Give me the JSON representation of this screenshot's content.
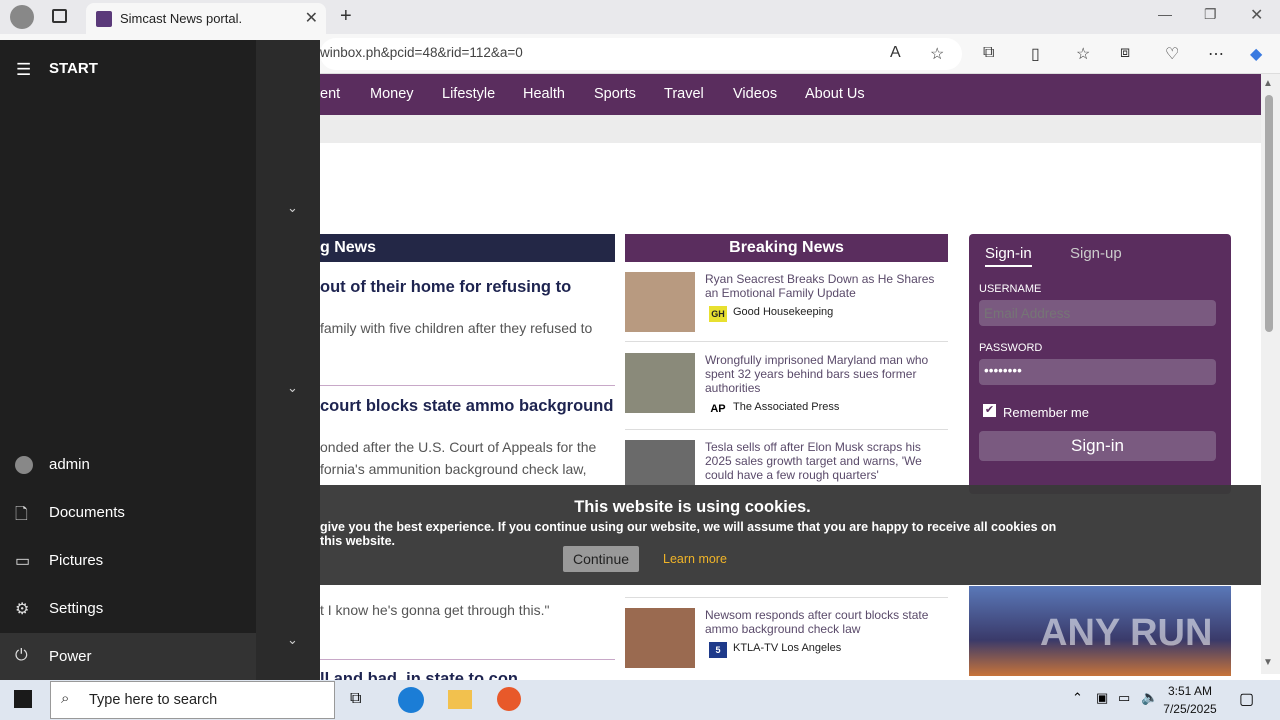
{
  "browser": {
    "tab_title": "Simcast News portal.",
    "url": "winbox.ph&pcid=48&rid=112&a=0"
  },
  "nav": [
    "ent",
    "Money",
    "Lifestyle",
    "Health",
    "Sports",
    "Travel",
    "Videos",
    "About Us"
  ],
  "left": {
    "header": "g News",
    "h1": "out of their home for refusing to",
    "p1": "family with five children after they refused to",
    "h2": "court blocks state ammo background",
    "p2a": "onded after the U.S. Court of Appeals for the",
    "p2b": "fornia's ammunition background check law,",
    "p3": "t I know he's gonna get through this.\"",
    "h3": "ll and bad, in state to con..."
  },
  "breaking": {
    "header": "Breaking News",
    "items": [
      {
        "title": "Ryan Seacrest Breaks Down as He Shares an Emotional Family Update",
        "source": "Good Housekeeping",
        "logo": "GH"
      },
      {
        "title": "Wrongfully imprisoned Maryland man who spent 32 years behind bars sues former authorities",
        "source": "The Associated Press",
        "logo": "AP"
      },
      {
        "title": "Tesla sells off after Elon Musk scraps his 2025 sales growth target and warns, 'We could have a few rough quarters'",
        "source": "",
        "logo": ""
      },
      {
        "title": "Newsom responds after court blocks state ammo background check law",
        "source": "KTLA-TV Los Angeles",
        "logo": "5"
      }
    ]
  },
  "signin": {
    "tab1": "Sign-in",
    "tab2": "Sign-up",
    "user_label": "USERNAME",
    "user_ph": "Email Address",
    "pass_label": "PASSWORD",
    "pass_val": "••••••••",
    "remember": "Remember me",
    "button": "Sign-in"
  },
  "cookie": {
    "title": "This website is using cookies.",
    "text": "give you the best experience. If you continue using our website, we will assume that you are happy to receive all cookies on this website.",
    "continue": "Continue",
    "learn": "Learn more"
  },
  "start": {
    "title": "START",
    "items": [
      "admin",
      "Documents",
      "Pictures",
      "Settings",
      "Power"
    ]
  },
  "taskbar": {
    "search_ph": "Type here to search",
    "time": "3:51 AM",
    "date": "7/25/2025"
  },
  "watermark": "ANY RUN"
}
